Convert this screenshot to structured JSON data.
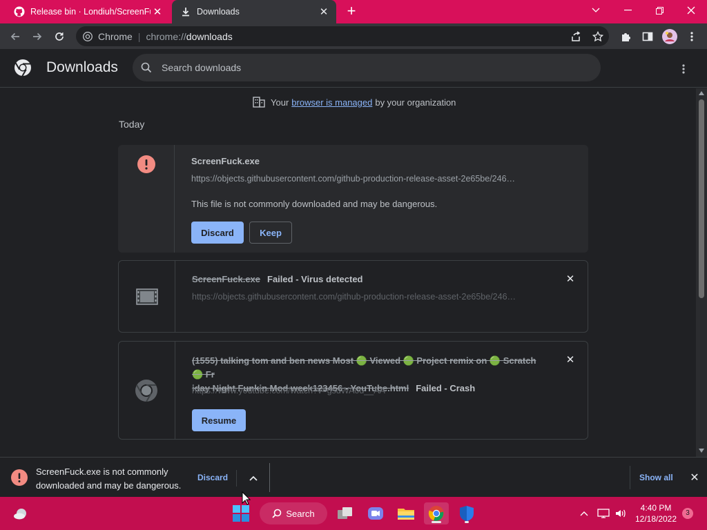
{
  "tabs": [
    {
      "title": "Release bin · Londiuh/ScreenFuck",
      "icon": "github-icon",
      "active": false
    },
    {
      "title": "Downloads",
      "icon": "download-icon",
      "active": true
    }
  ],
  "toolbar": {
    "site_label": "Chrome",
    "url_scheme": "chrome://",
    "url_host": "downloads"
  },
  "downloads": {
    "page_title": "Downloads",
    "search_placeholder": "Search downloads",
    "managed_prefix": "Your",
    "managed_link": "browser is managed",
    "managed_suffix": "by your organization",
    "section_label": "Today",
    "items": [
      {
        "filename": "ScreenFuck.exe",
        "url": "https://objects.githubusercontent.com/github-production-release-asset-2e65be/246…",
        "warning": "This file is not commonly downloaded and may be dangerous.",
        "discard_label": "Discard",
        "keep_label": "Keep"
      },
      {
        "filename": "ScreenFuck.exe",
        "status": "Failed - Virus detected",
        "url": "https://objects.githubusercontent.com/github-production-release-asset-2e65be/246…"
      },
      {
        "filename_line1": "(1555) talking tom and ben news Most 🟢 Viewed 🟢 Project remix on 🟢 Scratch 🟢 Fr",
        "filename_line2": "iday Night Funkin Mod week123456 - YouTube.html",
        "status": "Failed - Crash",
        "url": "https://www.youtube.com/watch?v=gsdWAou__AA",
        "resume_label": "Resume"
      }
    ]
  },
  "shelf": {
    "text": "ScreenFuck.exe is not commonly downloaded and may be dangerous.",
    "discard_label": "Discard",
    "show_all_label": "Show all"
  },
  "taskbar": {
    "search_label": "Search",
    "time": "4:40 PM",
    "date": "12/18/2022",
    "notification_count": "3"
  },
  "colors": {
    "accent": "#d8105a",
    "taskbar": "#c20e4f",
    "link": "#8ab4f8",
    "danger": "#f28b82"
  }
}
